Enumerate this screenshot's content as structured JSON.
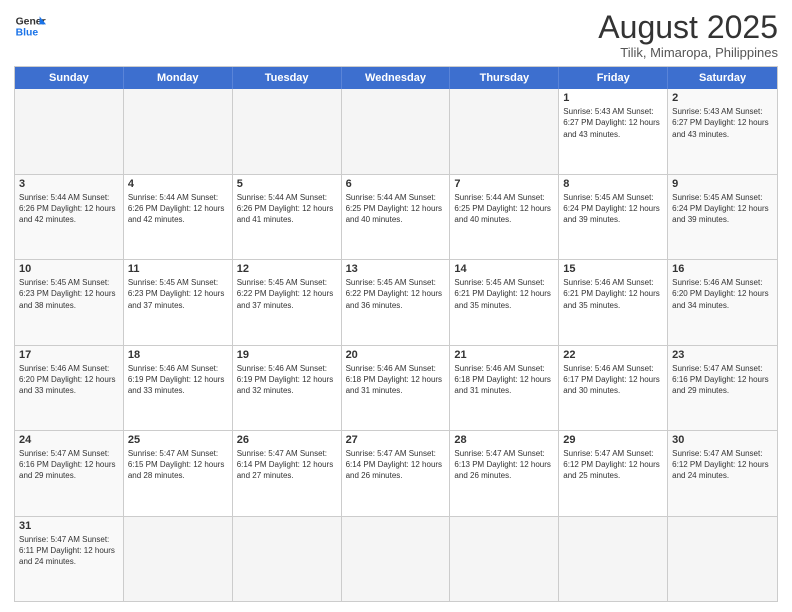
{
  "header": {
    "logo_general": "General",
    "logo_blue": "Blue",
    "title": "August 2025",
    "subtitle": "Tilik, Mimaropa, Philippines"
  },
  "days_of_week": [
    "Sunday",
    "Monday",
    "Tuesday",
    "Wednesday",
    "Thursday",
    "Friday",
    "Saturday"
  ],
  "weeks": [
    [
      {
        "day": "",
        "info": "",
        "empty": true
      },
      {
        "day": "",
        "info": "",
        "empty": true
      },
      {
        "day": "",
        "info": "",
        "empty": true
      },
      {
        "day": "",
        "info": "",
        "empty": true
      },
      {
        "day": "",
        "info": "",
        "empty": true
      },
      {
        "day": "1",
        "info": "Sunrise: 5:43 AM\nSunset: 6:27 PM\nDaylight: 12 hours\nand 43 minutes."
      },
      {
        "day": "2",
        "info": "Sunrise: 5:43 AM\nSunset: 6:27 PM\nDaylight: 12 hours\nand 43 minutes."
      }
    ],
    [
      {
        "day": "3",
        "info": "Sunrise: 5:44 AM\nSunset: 6:26 PM\nDaylight: 12 hours\nand 42 minutes."
      },
      {
        "day": "4",
        "info": "Sunrise: 5:44 AM\nSunset: 6:26 PM\nDaylight: 12 hours\nand 42 minutes."
      },
      {
        "day": "5",
        "info": "Sunrise: 5:44 AM\nSunset: 6:26 PM\nDaylight: 12 hours\nand 41 minutes."
      },
      {
        "day": "6",
        "info": "Sunrise: 5:44 AM\nSunset: 6:25 PM\nDaylight: 12 hours\nand 40 minutes."
      },
      {
        "day": "7",
        "info": "Sunrise: 5:44 AM\nSunset: 6:25 PM\nDaylight: 12 hours\nand 40 minutes."
      },
      {
        "day": "8",
        "info": "Sunrise: 5:45 AM\nSunset: 6:24 PM\nDaylight: 12 hours\nand 39 minutes."
      },
      {
        "day": "9",
        "info": "Sunrise: 5:45 AM\nSunset: 6:24 PM\nDaylight: 12 hours\nand 39 minutes."
      }
    ],
    [
      {
        "day": "10",
        "info": "Sunrise: 5:45 AM\nSunset: 6:23 PM\nDaylight: 12 hours\nand 38 minutes."
      },
      {
        "day": "11",
        "info": "Sunrise: 5:45 AM\nSunset: 6:23 PM\nDaylight: 12 hours\nand 37 minutes."
      },
      {
        "day": "12",
        "info": "Sunrise: 5:45 AM\nSunset: 6:22 PM\nDaylight: 12 hours\nand 37 minutes."
      },
      {
        "day": "13",
        "info": "Sunrise: 5:45 AM\nSunset: 6:22 PM\nDaylight: 12 hours\nand 36 minutes."
      },
      {
        "day": "14",
        "info": "Sunrise: 5:45 AM\nSunset: 6:21 PM\nDaylight: 12 hours\nand 35 minutes."
      },
      {
        "day": "15",
        "info": "Sunrise: 5:46 AM\nSunset: 6:21 PM\nDaylight: 12 hours\nand 35 minutes."
      },
      {
        "day": "16",
        "info": "Sunrise: 5:46 AM\nSunset: 6:20 PM\nDaylight: 12 hours\nand 34 minutes."
      }
    ],
    [
      {
        "day": "17",
        "info": "Sunrise: 5:46 AM\nSunset: 6:20 PM\nDaylight: 12 hours\nand 33 minutes."
      },
      {
        "day": "18",
        "info": "Sunrise: 5:46 AM\nSunset: 6:19 PM\nDaylight: 12 hours\nand 33 minutes."
      },
      {
        "day": "19",
        "info": "Sunrise: 5:46 AM\nSunset: 6:19 PM\nDaylight: 12 hours\nand 32 minutes."
      },
      {
        "day": "20",
        "info": "Sunrise: 5:46 AM\nSunset: 6:18 PM\nDaylight: 12 hours\nand 31 minutes."
      },
      {
        "day": "21",
        "info": "Sunrise: 5:46 AM\nSunset: 6:18 PM\nDaylight: 12 hours\nand 31 minutes."
      },
      {
        "day": "22",
        "info": "Sunrise: 5:46 AM\nSunset: 6:17 PM\nDaylight: 12 hours\nand 30 minutes."
      },
      {
        "day": "23",
        "info": "Sunrise: 5:47 AM\nSunset: 6:16 PM\nDaylight: 12 hours\nand 29 minutes."
      }
    ],
    [
      {
        "day": "24",
        "info": "Sunrise: 5:47 AM\nSunset: 6:16 PM\nDaylight: 12 hours\nand 29 minutes."
      },
      {
        "day": "25",
        "info": "Sunrise: 5:47 AM\nSunset: 6:15 PM\nDaylight: 12 hours\nand 28 minutes."
      },
      {
        "day": "26",
        "info": "Sunrise: 5:47 AM\nSunset: 6:14 PM\nDaylight: 12 hours\nand 27 minutes."
      },
      {
        "day": "27",
        "info": "Sunrise: 5:47 AM\nSunset: 6:14 PM\nDaylight: 12 hours\nand 26 minutes."
      },
      {
        "day": "28",
        "info": "Sunrise: 5:47 AM\nSunset: 6:13 PM\nDaylight: 12 hours\nand 26 minutes."
      },
      {
        "day": "29",
        "info": "Sunrise: 5:47 AM\nSunset: 6:12 PM\nDaylight: 12 hours\nand 25 minutes."
      },
      {
        "day": "30",
        "info": "Sunrise: 5:47 AM\nSunset: 6:12 PM\nDaylight: 12 hours\nand 24 minutes."
      }
    ],
    [
      {
        "day": "31",
        "info": "Sunrise: 5:47 AM\nSunset: 6:11 PM\nDaylight: 12 hours\nand 24 minutes."
      },
      {
        "day": "",
        "info": "",
        "empty": true
      },
      {
        "day": "",
        "info": "",
        "empty": true
      },
      {
        "day": "",
        "info": "",
        "empty": true
      },
      {
        "day": "",
        "info": "",
        "empty": true
      },
      {
        "day": "",
        "info": "",
        "empty": true
      },
      {
        "day": "",
        "info": "",
        "empty": true
      }
    ]
  ]
}
